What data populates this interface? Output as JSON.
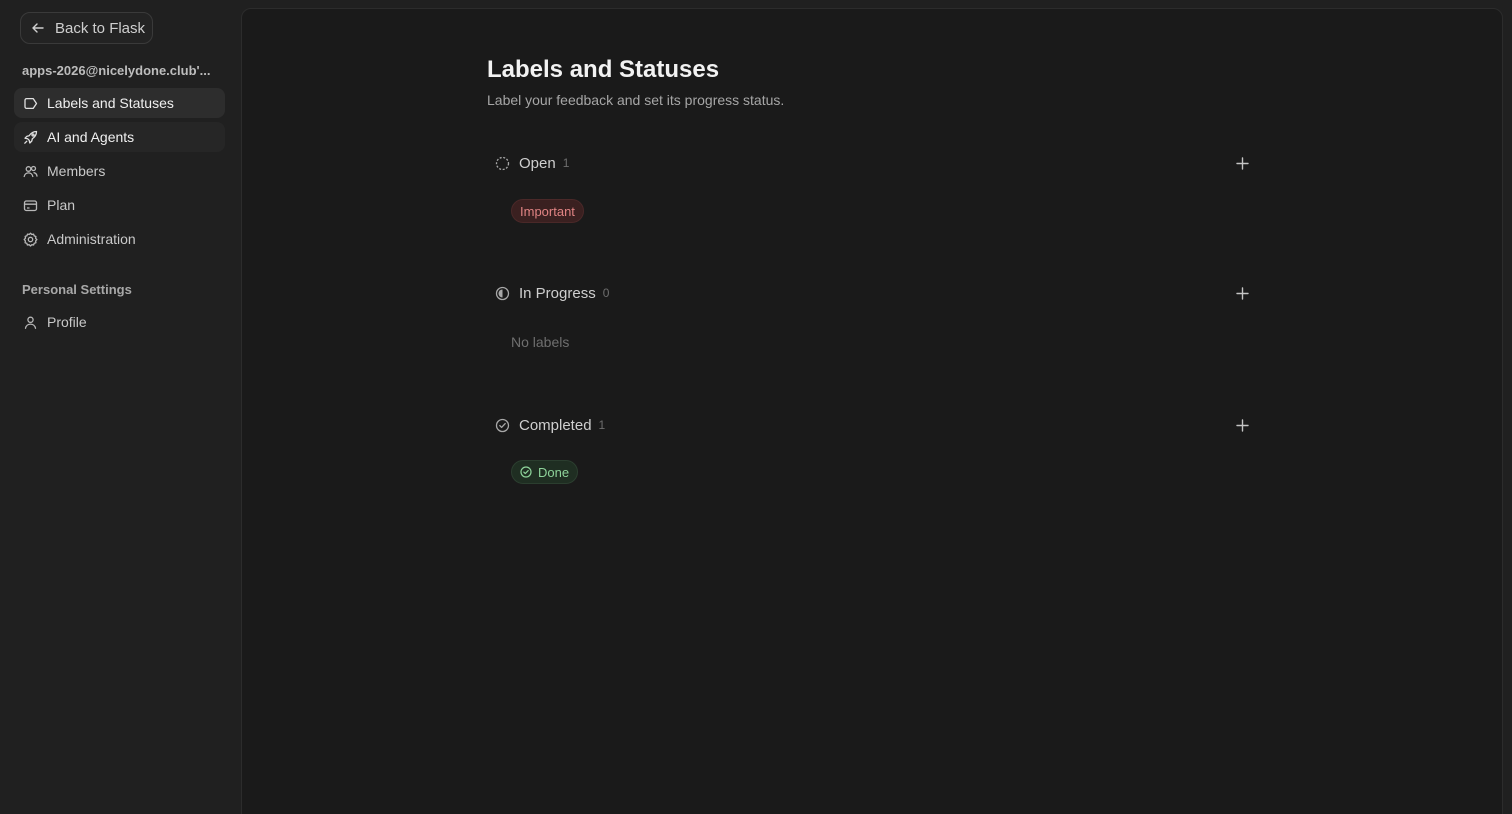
{
  "sidebar": {
    "back_label": "Back to Flask",
    "workspace": "apps-2026@nicelydone.club'...",
    "items": [
      {
        "label": "Labels and Statuses",
        "icon": "tag-icon"
      },
      {
        "label": "AI and Agents",
        "icon": "rocket-icon"
      },
      {
        "label": "Members",
        "icon": "users-icon"
      },
      {
        "label": "Plan",
        "icon": "card-icon"
      },
      {
        "label": "Administration",
        "icon": "gear-icon"
      }
    ],
    "personal_heading": "Personal Settings",
    "personal_items": [
      {
        "label": "Profile",
        "icon": "user-icon"
      }
    ]
  },
  "main": {
    "title": "Labels and Statuses",
    "subtitle": "Label your feedback and set its progress status.",
    "groups": [
      {
        "name": "Open",
        "count": "1",
        "icon": "dashed-circle-icon",
        "labels": [
          "Important"
        ]
      },
      {
        "name": "In Progress",
        "count": "0",
        "icon": "half-circle-icon",
        "empty_text": "No labels"
      },
      {
        "name": "Completed",
        "count": "1",
        "icon": "check-circle-icon",
        "labels": [
          "Done"
        ]
      }
    ]
  },
  "colors": {
    "important_text": "#e08383",
    "important_bg": "#3a2020",
    "done_text": "#8ed39a",
    "done_bg": "#1f2e22"
  }
}
